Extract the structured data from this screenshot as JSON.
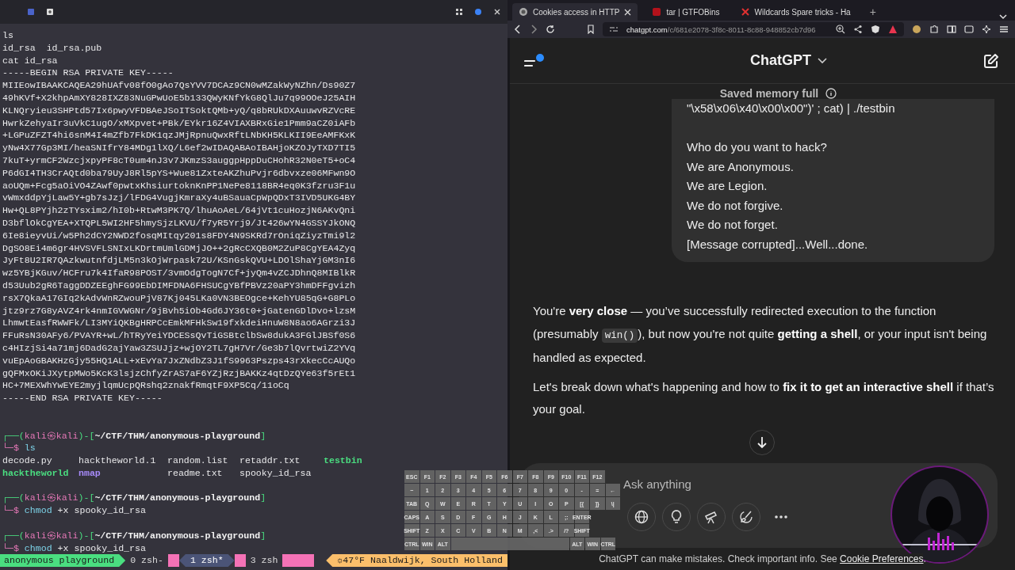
{
  "terminal": {
    "lines": [
      "ls",
      "id_rsa  id_rsa.pub",
      "cat id_rsa",
      "-----BEGIN RSA PRIVATE KEY-----",
      "MIIEowIBAAKCAQEA29hUAfv08fO0gAo7QsYVV7DCAz9CN0wMZakWyNZhn/Ds90Z7",
      "49hKVf+X2khpAmXY828IXZ83NuGPwUoE5b133QWyKNfYkG8QlJu7q99OOeJ25AIH",
      "KLNQryieu3SHPtd57Ix6pwyVFDBAeJSoITSoktQMb+yQ/q8bRUkDXAuuwvRZVcRE",
      "HwrkZehyaIr3uVkC1ugO/xMXpvet+PBk/EYkr16Z4VIAXBRxGie1Pmm9aCZ0iAFb",
      "+LGPuZFZT4hi6snM4I4mZfb7FkDK1qzJMjRpnuQwxRftLNbKH5KLKII9EeAMFKxK",
      "yNw4X77Gp3MI/heaSNIfrY84MDg1lXQ/L6ef2wIDAQABAoIBAHjoKZOJyTXD7TI5",
      "7kuT+yrmCF2WzcjxpyPF8cT0um4nJ3v7JKmzS3auggpHppDuCHohR32N0eT5+oC4",
      "P6dGI4TH3CrAQtd0ba79UyJ8Rl5pYS+Wue81ZxteAKZhuPvjr6dbvxze06MFwn9O",
      "aoUQm+Fcg5aOiVO4ZAwf0pwtxKhsiurtoknKnPP1NePe8118BR4eq0K3fzru3F1u",
      "vWmxddpYjLaw5Y+gb7sJzj/lFDG4VugjKmraXy4uBSauaCpWpQDxT3IVD5UKG4BY",
      "Hw+QL8PYjh2zTYsxim2/hI0b+RtwM3PK7Q/lhuAoAeL/64jVt1cuHozjN6AKvQni",
      "D3bflOkCgYEA+XTQPL5WI2HF5hmySjzLKVU/f7yR5Yrj9/Jt426wYN4GSSYJkONQ",
      "6Ie8ieyvUi/w5Ph2dCY2NWD2fosqMItqy201s8FDY4N9SKRd7rOniqZiyzTmi9l2",
      "DgSO8Ei4m6gr4HVSVFLSNIxLKDrtmUmlGDMjJO++2gRcCXQB0M2ZuP8CgYEA4Zyq",
      "JyFt8U2IR7QAzkwutnfdjLM5n3kOjWrpask72U/KSnGskQVU+LDOlShaYjGM3nI6",
      "wz5YBjKGuv/HCFru7k4IfaR98POST/3vmOdgTogN7Cf+jyQm4vZCJDhnQ8MIBlkR",
      "d53Uub2gR6TaggDDZEEghFG99EbDIMFDNA6FHSUCgYBfPBVz20aPY3hmDFFgvizh",
      "rsX7QkaA17GIq2kAdvWnRZwouPjV87Kj045LKa0VN3BEOgce+KehYU85qG+G8PLo",
      "jtz9rz7G8yAVZ4rk4nmIGVWGNr/9jBvh5iOb4Gd6JY36t0+jGatenGDlDvo+lzsM",
      "LhmwtEasfRWWFk/LI3MYiQKBgHRPCcEmkMFHkSw19fxkdeiHnuW8N8ao6AGrzi3J",
      "FFuRsN30AFy6/PVAYR+wL/hTRyYeiYDCESsQvTiGSBtclbSw8dukA3FGlJBSf0S6",
      "c4HIzjSi4a71mj6DadG2ajYaw3ZSUJjz+wjOY2TL7gH7Vr/Ge3b7lQvrtwiZ2YVq",
      "vuEpAoGBAKHzGjy55HQ1ALL+xEvYa7JxZNdbZ3J1fS9963Pszps43rXkecCcAUQo",
      "gQFMxOKiJXytpMWo5KcK3lsjzChfyZrAS7aF6YZjRzjBAKKz4qtDzQYe63f5rEt1",
      "HC+7MEXWhYwEYE2myjlqmUcpQRshq2znakfRmqtF9XP5Cq/11oCq",
      "-----END RSA PRIVATE KEY-----"
    ],
    "commands": [
      {
        "open": "┌──(",
        "user": "kali㉿kali",
        "mid": ")-[",
        "path": "~/CTF/THM/anonymous-playground",
        "close": "]",
        "marker": "└─$",
        "program": "ls",
        "listing": [
          {
            "name": "decode.py",
            "kind": "file"
          },
          {
            "name": "hacktheworld.1",
            "kind": "file"
          },
          {
            "name": "random.list",
            "kind": "file"
          },
          {
            "name": "retaddr.txt",
            "kind": "file"
          },
          {
            "name": "testbin",
            "kind": "exec"
          },
          {
            "name": "hacktheworld",
            "kind": "exec"
          },
          {
            "name": "nmap",
            "kind": "dir"
          },
          {
            "name": "readme.txt",
            "kind": "file"
          },
          {
            "name": "spooky_id_rsa",
            "kind": "file"
          }
        ]
      },
      {
        "open": "┌──(",
        "user": "kali㉿kali",
        "mid": ")-[",
        "path": "~/CTF/THM/anonymous-playground",
        "close": "]",
        "marker": "└─$",
        "program": "chmod",
        "args": "+x spooky_id_rsa"
      },
      {
        "open": "┌──(",
        "user": "kali㉿kali",
        "mid": ")-[",
        "path": "~/CTF/THM/anonymous-playground",
        "close": "]",
        "marker": "└─$",
        "program": "chmod",
        "args": "+x spooky_id_rsa"
      }
    ],
    "status_bar": {
      "session": "anonymous playground",
      "windows": [
        {
          "label": "0 zsh-",
          "selected": false
        },
        {
          "label": "1 zsh*",
          "selected": true
        },
        {
          "label": "3 zsh",
          "selected": false
        }
      ],
      "weather": "☼47°F Naaldwijk, South Holland"
    }
  },
  "keyboard": {
    "rows": [
      [
        "ESC",
        "F1",
        "F2",
        "F3",
        "F4",
        "F5",
        "F6",
        "F7",
        "F8",
        "F9",
        "F10",
        "F11",
        "F12"
      ],
      [
        "~",
        "1",
        "2",
        "3",
        "4",
        "5",
        "6",
        "7",
        "8",
        "9",
        "0",
        "-",
        "=",
        "←"
      ],
      [
        "TAB",
        "Q",
        "W",
        "E",
        "R",
        "T",
        "Y",
        "U",
        "I",
        "O",
        "P",
        "[{",
        "]}",
        "\\|"
      ],
      [
        "CAPS",
        "A",
        "S",
        "D",
        "F",
        "G",
        "H",
        "J",
        "K",
        "L",
        ";:",
        "ENTER"
      ],
      [
        "SHIFT",
        "Z",
        "X",
        "C",
        "V",
        "B",
        "N",
        "M",
        ",<",
        ".>",
        "/?",
        "SHIFT"
      ],
      [
        "CTRL",
        "WIN",
        "ALT"
      ]
    ],
    "right_keys": [
      "ALT",
      "WIN",
      "CTRL"
    ]
  },
  "browser": {
    "tabs": [
      {
        "title": "Cookies access in HTTP",
        "selected": true
      },
      {
        "title": "tar | GTFOBins",
        "selected": false
      },
      {
        "title": "Wildcards Spare tricks - Ha",
        "selected": false
      }
    ],
    "new_tab": "+",
    "url_host": "chatgpt.com",
    "url_path": "/c/681e2078-3f8c-8011-8c88-948852cb7d96",
    "app_title": "ChatGPT",
    "memory_notice": "Saved memory full",
    "user_message": [
      "\"\\x58\\x06\\x40\\x00\\x00\")' ; cat) | ./testbin",
      "Who do you want to hack?",
      "We are Anonymous.",
      "We are Legion.",
      "We do not forgive.",
      "We do not forget.",
      "[Message corrupted]...Well...done."
    ],
    "assistant": [
      [
        {
          "kind": "text",
          "text": "You're **very close** — you’ve successfully redirected execution to the function (presumably "
        },
        {
          "kind": "code",
          "text": "win()"
        },
        {
          "kind": "text",
          "text": "), but now you're not quite **getting a shell**, or your input isn't being handled as expected."
        }
      ],
      [
        {
          "kind": "text",
          "text": "Let's break down what's happening and how to **fix it to get an interactive shell** if that’s your goal."
        }
      ]
    ],
    "composer": {
      "placeholder": "Ask anything"
    },
    "footer": {
      "text": "ChatGPT can make mistakes. Check important info. See ",
      "link": "Cookie Preferences",
      "end": "."
    }
  }
}
